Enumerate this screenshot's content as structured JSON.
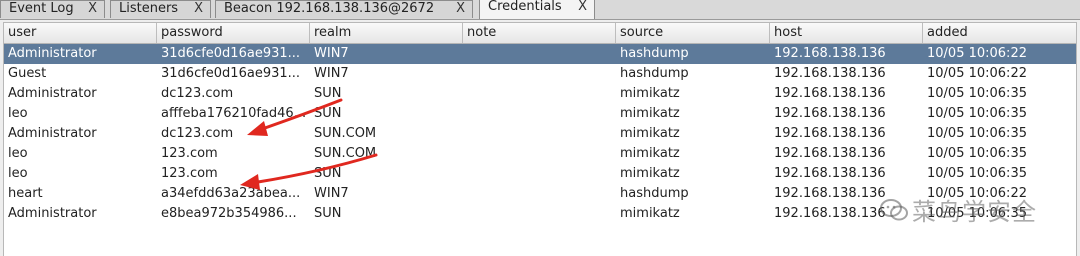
{
  "tabs": [
    {
      "label": "Event Log",
      "close": "X"
    },
    {
      "label": "Listeners",
      "close": "X"
    },
    {
      "label": "Beacon 192.168.138.136@2672",
      "close": "X"
    },
    {
      "label": "Credentials",
      "close": "X"
    }
  ],
  "active_tab": "Credentials",
  "table": {
    "columns": [
      "user",
      "password",
      "realm",
      "note",
      "source",
      "host",
      "added"
    ],
    "rows": [
      {
        "selected": true,
        "cells": [
          "Administrator",
          "31d6cfe0d16ae931...",
          "WIN7",
          "",
          "hashdump",
          "192.168.138.136",
          "10/05 10:06:22"
        ]
      },
      {
        "cells": [
          "Guest",
          "31d6cfe0d16ae931...",
          "WIN7",
          "",
          "hashdump",
          "192.168.138.136",
          "10/05 10:06:22"
        ]
      },
      {
        "cells": [
          "Administrator",
          "dc123.com",
          "SUN",
          "",
          "mimikatz",
          "192.168.138.136",
          "10/05 10:06:35"
        ]
      },
      {
        "cells": [
          "leo",
          "afffeba176210fad46...",
          "SUN",
          "",
          "mimikatz",
          "192.168.138.136",
          "10/05 10:06:35"
        ]
      },
      {
        "cells": [
          "Administrator",
          "dc123.com",
          "SUN.COM",
          "",
          "mimikatz",
          "192.168.138.136",
          "10/05 10:06:35"
        ]
      },
      {
        "cells": [
          "leo",
          "123.com",
          "SUN.COM",
          "",
          "mimikatz",
          "192.168.138.136",
          "10/05 10:06:35"
        ]
      },
      {
        "cells": [
          "leo",
          "123.com",
          "SUN",
          "",
          "mimikatz",
          "192.168.138.136",
          "10/05 10:06:35"
        ]
      },
      {
        "cells": [
          "heart",
          "a34efdd63a23abea...",
          "WIN7",
          "",
          "hashdump",
          "192.168.138.136",
          "10/05 10:06:22"
        ]
      },
      {
        "cells": [
          "Administrator",
          "e8bea972b354986...",
          "SUN",
          "",
          "mimikatz",
          "192.168.138.136",
          "10/05 10:06:35"
        ]
      }
    ]
  },
  "watermark": {
    "text": "菜鸟学安全",
    "icon": "wechat-icon"
  },
  "colors": {
    "selected_row": "#5d7a9a",
    "annotation_arrow": "#e0281f"
  }
}
